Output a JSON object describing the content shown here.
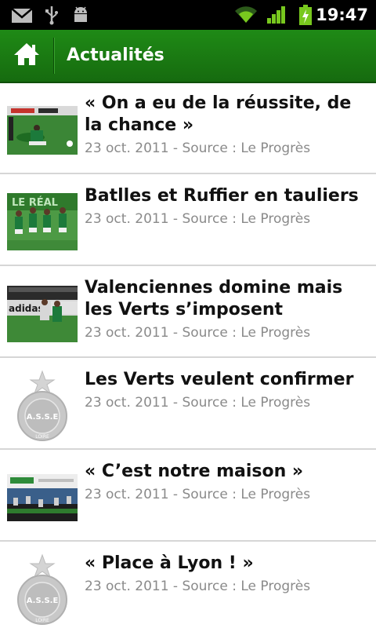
{
  "status_bar": {
    "time": "19:47",
    "icons": [
      "gmail-icon",
      "usb-icon",
      "android-debug-icon",
      "wifi-icon",
      "signal-icon",
      "battery-charging-icon"
    ]
  },
  "action_bar": {
    "title": "Actualités",
    "home_icon": "home-icon"
  },
  "news": [
    {
      "title": "« On a eu de la réussite, de la chance »",
      "meta": "23 oct. 2011 - Source : Le Progrès",
      "thumb": "photo-match-1"
    },
    {
      "title": "Batlles et Ruffier en tauliers",
      "meta": "23 oct. 2011 - Source : Le Progrès",
      "thumb": "photo-players"
    },
    {
      "title": "Valenciennes domine mais les Verts s’imposent",
      "meta": "23 oct. 2011 - Source : Le Progrès",
      "thumb": "photo-match-2"
    },
    {
      "title": "Les Verts veulent confirmer",
      "meta": "23 oct. 2011 - Source : Le Progrès",
      "thumb": "asse-logo"
    },
    {
      "title": "« C’est notre maison »",
      "meta": "23 oct. 2011 - Source : Le Progrès",
      "thumb": "photo-stadium"
    },
    {
      "title": "« Place à Lyon ! »",
      "meta": "23 oct. 2011 - Source : Le Progrès",
      "thumb": "asse-logo"
    }
  ],
  "colors": {
    "action_bar": "#1a7d12",
    "title_text": "#111111",
    "meta_text": "#8a8a8a",
    "divider": "#d6d6d6"
  }
}
